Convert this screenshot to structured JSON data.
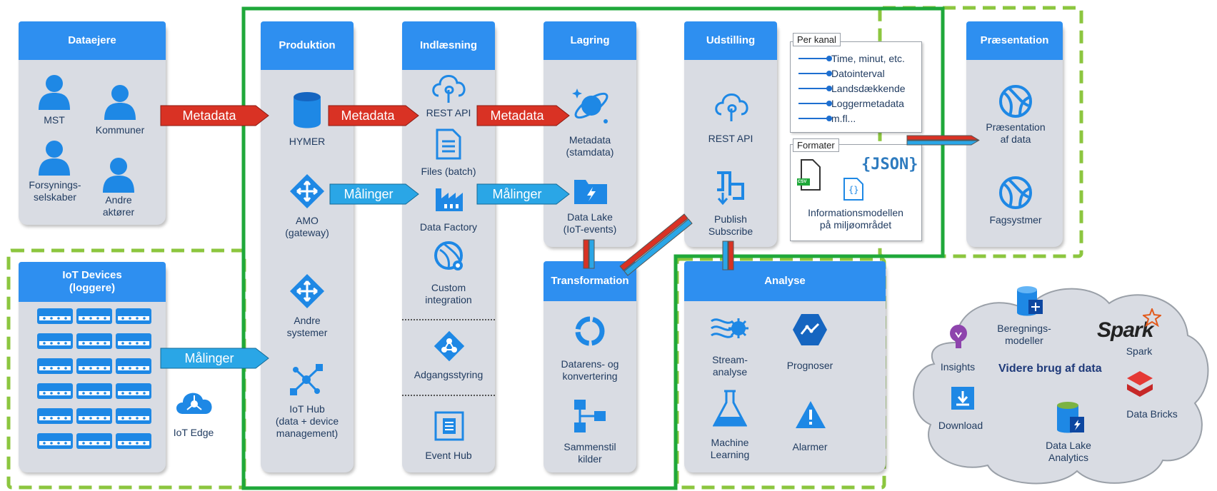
{
  "columns": {
    "dataejere": {
      "title": "Dataejere",
      "mst": "MST",
      "kommuner": "Kommuner",
      "forsyning": "Forsynings-\nselskaber",
      "andre": "Andre\naktører"
    },
    "iot": {
      "title": "IoT Devices\n(loggere)",
      "edge": "IoT Edge"
    },
    "produktion": {
      "title": "Produktion",
      "hymer": "HYMER",
      "amo": "AMO\n(gateway)",
      "andre": "Andre\nsystemer",
      "hub": "IoT Hub\n(data + device\nmanagement)"
    },
    "indlaesning": {
      "title": "Indlæsning",
      "rest": "REST API",
      "files": "Files (batch)",
      "factory": "Data Factory",
      "custom": "Custom\nintegration",
      "adgang": "Adgangsstyring",
      "eventhub": "Event Hub"
    },
    "lagring": {
      "title": "Lagring",
      "metadata": "Metadata\n(stamdata)",
      "lake": "Data Lake\n(IoT-events)"
    },
    "transformation": {
      "title": "Transformation",
      "datarens": "Datarens- og\nkonvertering",
      "sammenstil": "Sammenstil\nkilder"
    },
    "udstilling": {
      "title": "Udstilling",
      "rest": "REST API",
      "publish": "Publish\nSubscribe"
    },
    "analyse": {
      "title": "Analyse",
      "stream": "Stream-\nanalyse",
      "prognoser": "Prognoser",
      "ml": "Machine\nLearning",
      "alarmer": "Alarmer"
    },
    "praesentation": {
      "title": "Præsentation",
      "praes": "Præsentation\naf data",
      "fag": "Fagsystmer"
    }
  },
  "perkanal": {
    "tag": "Per kanal",
    "items": [
      "Time, minut, etc.",
      "Datointerval",
      "Landsdækkende",
      "Loggermetadata",
      "m.fl..."
    ]
  },
  "formater": {
    "tag": "Formater",
    "json": "{JSON}",
    "csv": "CSV",
    "desc": "Informationsmodellen\npå miljøområdet"
  },
  "arrows": {
    "metadata": "Metadata",
    "maalinger": "Målinger"
  },
  "cloud": {
    "title": "Videre brug af data",
    "beregning": "Beregnings-\nmodeller",
    "spark_logo": "Spark",
    "spark": "Spark",
    "insights": "Insights",
    "download": "Download",
    "lakeanalytics": "Data Lake\nAnalytics",
    "bricks": "Data Bricks"
  },
  "colors": {
    "header": "#2e8ff0",
    "column": "#d9dce3",
    "icon": "#1e88e5",
    "green": "#1fa83a",
    "dashed": "#8cc63f",
    "metadata_arrow": "#d93224",
    "maalinger_arrow": "#2aa6e6"
  }
}
